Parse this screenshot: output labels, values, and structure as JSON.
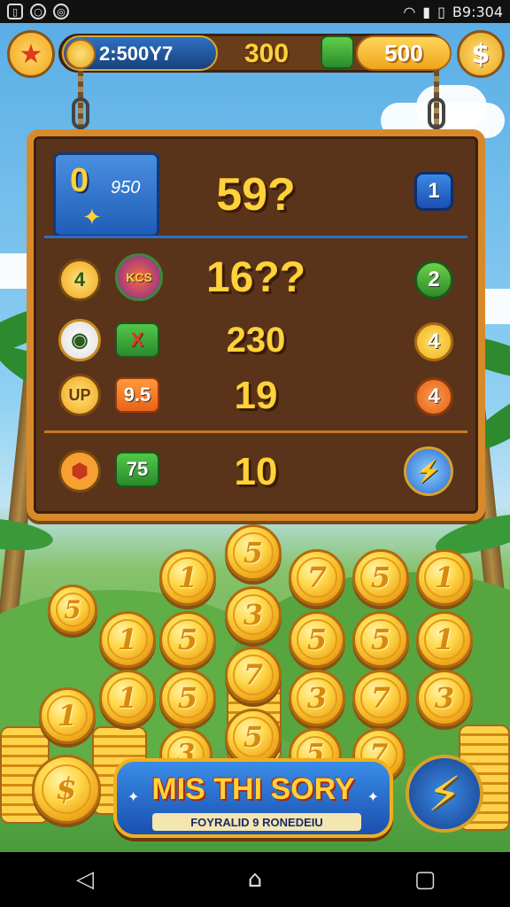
{
  "status_bar": {
    "time": "B9:304"
  },
  "hud": {
    "coin_balance": "2:500Y7",
    "center_value": "300",
    "gold_value": "500"
  },
  "board": {
    "header_tile_big": "0",
    "header_tile_small": "950",
    "header_count": "59?",
    "header_badge": "1",
    "rows": [
      {
        "left_badge": "4",
        "tag": "KCS",
        "count": "16??",
        "right_badge": "2"
      },
      {
        "left_badge": "",
        "tag": "X",
        "count": "230",
        "right_badge": "4"
      },
      {
        "left_badge": "UP",
        "tag": "9.5",
        "count": "19",
        "right_badge": "4"
      },
      {
        "left_badge": "",
        "tag": "75",
        "count": "10",
        "right_badge": ""
      }
    ]
  },
  "coins": {
    "faces": [
      "5",
      "1",
      "7",
      "5",
      "1",
      "1",
      "5",
      "3",
      "5",
      "5",
      "1",
      "1",
      "5",
      "7",
      "3",
      "7",
      "3",
      "1",
      "5",
      "3",
      "5",
      "7",
      "5",
      "5",
      "$"
    ]
  },
  "banner": {
    "title": "MIS THI SORY",
    "subtitle": "FOYRALID 9 RONEDEIU"
  },
  "colors": {
    "board_wood": "#5a331b",
    "board_frame": "#d88a2a",
    "gold_text": "#ffd23a",
    "banner_blue": "#1a4fb0"
  }
}
